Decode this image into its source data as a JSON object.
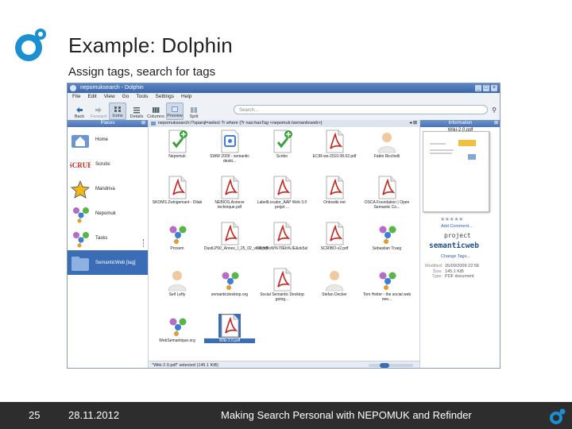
{
  "slide": {
    "title": "Example: Dolphin",
    "subtitle": "Assign tags, search for tags",
    "accent": "#1a8fd1"
  },
  "window": {
    "title": "nepomuksearch - Dolphin",
    "menu": [
      "File",
      "Edit",
      "View",
      "Go",
      "Tools",
      "Settings",
      "Help"
    ],
    "toolbar": [
      {
        "label": "Back",
        "icon": "arrow-left-icon"
      },
      {
        "label": "Forward",
        "icon": "arrow-right-icon"
      },
      {
        "label": "Icons",
        "icon": "icons-view-icon"
      },
      {
        "label": "Details",
        "icon": "details-view-icon"
      },
      {
        "label": "Columns",
        "icon": "columns-view-icon"
      },
      {
        "label": "Preview",
        "icon": "preview-icon"
      },
      {
        "label": "Split",
        "icon": "split-icon"
      }
    ],
    "search_placeholder": "Search..."
  },
  "places": {
    "header": "Places",
    "items": [
      {
        "label": "Home",
        "icon": "home-folder-icon"
      },
      {
        "label": "Scrubs",
        "icon": "scrubs-logo-icon"
      },
      {
        "label": "Mandriva",
        "icon": "mandriva-star-icon"
      },
      {
        "label": "Nepomuk",
        "icon": "nepomuk-molecule-icon"
      },
      {
        "label": "Tasks",
        "icon": "nepomuk-molecule-icon"
      },
      {
        "label": "SemanticWeb [tag]",
        "icon": "tag-folder-icon"
      }
    ]
  },
  "location": "nepomuksearch:/?sparql=select ?r where {?r nao:hasTag <nepomuk:/semanticweb>}",
  "files": [
    {
      "label": "Nepomuk",
      "icon": "nepomuk-plus-icon"
    },
    {
      "label": "SWW 2009 - semantic deskt...",
      "icon": "document-blue-icon"
    },
    {
      "label": "Scribo",
      "icon": "nepomuk-plus-icon"
    },
    {
      "label": "ECIR-ws-2010.08.02.pdf",
      "icon": "pdf-icon"
    },
    {
      "label": "Fabio Ricchelli",
      "icon": "person-icon"
    },
    {
      "label": "SKOMS Zwingemant - Dilab",
      "icon": "pdf-icon"
    },
    {
      "label": "NEBIOS.Annexe technique.pdf",
      "icon": "pdf-icon"
    },
    {
      "label": "LabellLocator_AAP Web 3.0 projet ...",
      "icon": "pdf-icon"
    },
    {
      "label": "Ontowiki.net",
      "icon": "pdf-icon"
    },
    {
      "label": "OSCA Foundation | Open Semantic Co...",
      "icon": "pdf-icon"
    },
    {
      "label": "Proxem",
      "icon": "nepomuk-molecule-icon"
    },
    {
      "label": "DustLP50_Annex_I_25_02_v6.6.pdf",
      "icon": "pdf-icon"
    },
    {
      "label": "rWr%5oW%79Eb%JE&ok5a!",
      "icon": "pdf-icon"
    },
    {
      "label": "SCRIBO-v2.pdf",
      "icon": "pdf-icon"
    },
    {
      "label": "Sebastian Trueg",
      "icon": "nepomuk-molecule-icon"
    },
    {
      "label": "Seif Lefty",
      "icon": "person-icon"
    },
    {
      "label": "semanticdesktop.org",
      "icon": "nepomuk-molecule-icon"
    },
    {
      "label": "Social Semantic Desktop going...",
      "icon": "pdf-icon"
    },
    {
      "label": "Stefan Decker",
      "icon": "person-icon"
    },
    {
      "label": "Tom Heiter - the social web nee...",
      "icon": "nepomuk-molecule-icon"
    },
    {
      "label": "WebSemantique.org",
      "icon": "nepomuk-molecule-icon"
    },
    {
      "label": "Wiki-2.0.pdf",
      "icon": "pdf-icon",
      "selected": true
    }
  ],
  "status": "\"Wiki-2.0.pdf\" selected (145.1 KiB)",
  "info": {
    "header": "Information",
    "filename": "Wiki-2.0.pdf",
    "add_comment": "Add Comment...",
    "tag_project": "project",
    "tag_semanticweb": "semanticweb",
    "change_tags": "Change Tags...",
    "meta": [
      {
        "key": "Modified:",
        "value": "26/09/2009 22:58"
      },
      {
        "key": "Size:",
        "value": "145.1 KiB"
      },
      {
        "key": "Type:",
        "value": "PDF document"
      }
    ]
  },
  "footer": {
    "page": "25",
    "date": "28.11.2012",
    "text": "Making Search Personal with NEPOMUK and Refinder"
  }
}
